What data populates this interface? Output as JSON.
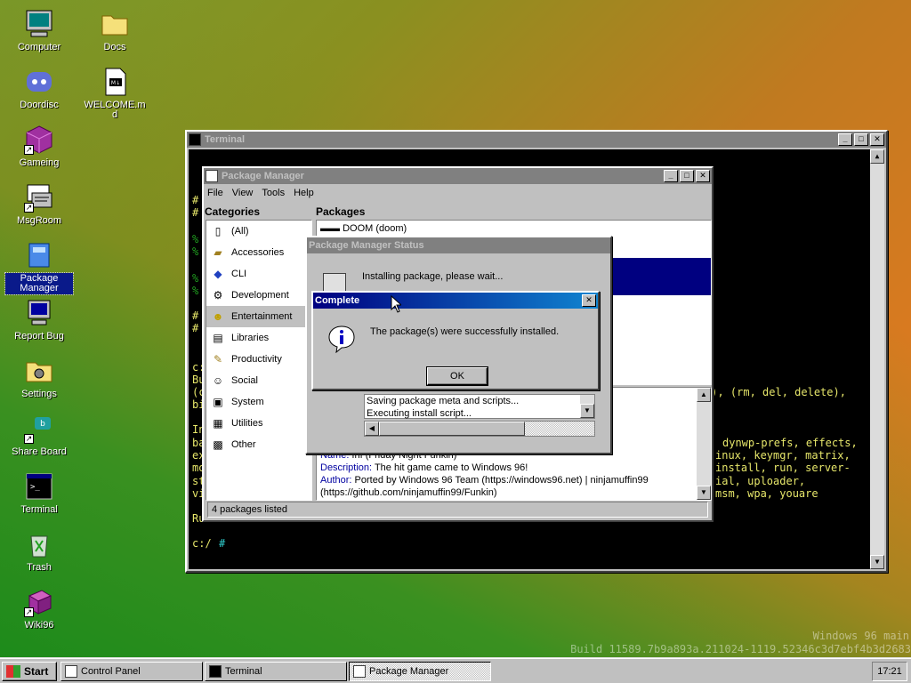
{
  "desktop": {
    "icons": [
      {
        "label": "Computer",
        "icon": "computer-icon"
      },
      {
        "label": "Docs",
        "icon": "folder-icon"
      },
      {
        "label": "Doordisc",
        "icon": "discord-icon"
      },
      {
        "label": "WELCOME.md",
        "icon": "markdown-file-icon"
      },
      {
        "label": "Gameing",
        "icon": "game-cube-icon"
      },
      {
        "label": "MsgRoom",
        "icon": "chat-icon"
      },
      {
        "label": "Package Manager",
        "icon": "package-icon"
      },
      {
        "label": "Report Bug",
        "icon": "bug-report-icon"
      },
      {
        "label": "Settings",
        "icon": "settings-icon"
      },
      {
        "label": "Share Board",
        "icon": "share-board-icon"
      },
      {
        "label": "Terminal",
        "icon": "terminal-icon"
      },
      {
        "label": "Trash",
        "icon": "trash-icon"
      },
      {
        "label": "Wiki96",
        "icon": "wiki-book-icon"
      }
    ],
    "watermark": {
      "line1": "Windows 96 main",
      "line2": "Build 11589.7b9a893a.211024-1119.52346c3d7ebf4b3d2683"
    }
  },
  "terminal": {
    "title": "Terminal",
    "lines": {
      "l1": "#",
      "l2": "#",
      "l3": "%",
      "l4": "%",
      "l5": "%",
      "l6": "%",
      "l7": "#",
      "l8": "#",
      "l9": "c:",
      "l10": "Bu",
      "l11": "(c",
      "l11r": "e), (rm, del, delete),",
      "l12": "bi",
      "l13": "In",
      "l14": "ba",
      "l14r": "dynwp-prefs, effects,",
      "l15": "ex",
      "l15r": "inux, keymgr, matrix,",
      "l16": "mo",
      "l16r": "install, run, server-",
      "l17": "st",
      "l17r": "ial, uploader,",
      "l18": "vi",
      "l18r": "msm, wpa, youare",
      "l19": "Ru",
      "prompt": "c:/",
      "prompt_sym": "#"
    }
  },
  "pkgmgr": {
    "title": "Package Manager",
    "menu": [
      "File",
      "View",
      "Tools",
      "Help"
    ],
    "categories_label": "Categories",
    "packages_label": "Packages",
    "categories": [
      {
        "label": "(All)",
        "icon": "all-icon"
      },
      {
        "label": "Accessories",
        "icon": "accessories-icon"
      },
      {
        "label": "CLI",
        "icon": "cli-icon"
      },
      {
        "label": "Development",
        "icon": "development-icon"
      },
      {
        "label": "Entertainment",
        "icon": "smiley-icon"
      },
      {
        "label": "Libraries",
        "icon": "libraries-icon"
      },
      {
        "label": "Productivity",
        "icon": "productivity-icon"
      },
      {
        "label": "Social",
        "icon": "social-icon"
      },
      {
        "label": "System",
        "icon": "system-icon"
      },
      {
        "label": "Utilities",
        "icon": "utilities-icon"
      },
      {
        "label": "Other",
        "icon": "other-icon"
      }
    ],
    "packages": [
      "DOOM (doom)"
    ],
    "desc": {
      "name_key": "Name:",
      "name_val": "fnf (Friday Night Funkin)",
      "desc_key": "Description:",
      "desc_val": "The hit game came to Windows 96!",
      "author_key": "Author:",
      "author_val": "Ported by Windows 96 Team (https://windows96.net) | ninjamuffin99",
      "author_val2": "(https://github.com/ninjamuffin99/Funkin)"
    },
    "status": "4 packages listed"
  },
  "status_dialog": {
    "title": "Package Manager Status",
    "message": "Installing package, please wait...",
    "log": [
      "Saving package meta and scripts...",
      "Executing install script..."
    ]
  },
  "complete_dialog": {
    "title": "Complete",
    "message": "The package(s) were successfully installed.",
    "ok": "OK"
  },
  "taskbar": {
    "start": "Start",
    "tasks": [
      {
        "label": "Control Panel"
      },
      {
        "label": "Terminal"
      },
      {
        "label": "Package Manager"
      }
    ],
    "clock": "17:21"
  },
  "colors": {
    "title_active": "#000080",
    "title_inactive": "#808080",
    "terminal_text": "#e6e66a",
    "selection": "#000080"
  }
}
